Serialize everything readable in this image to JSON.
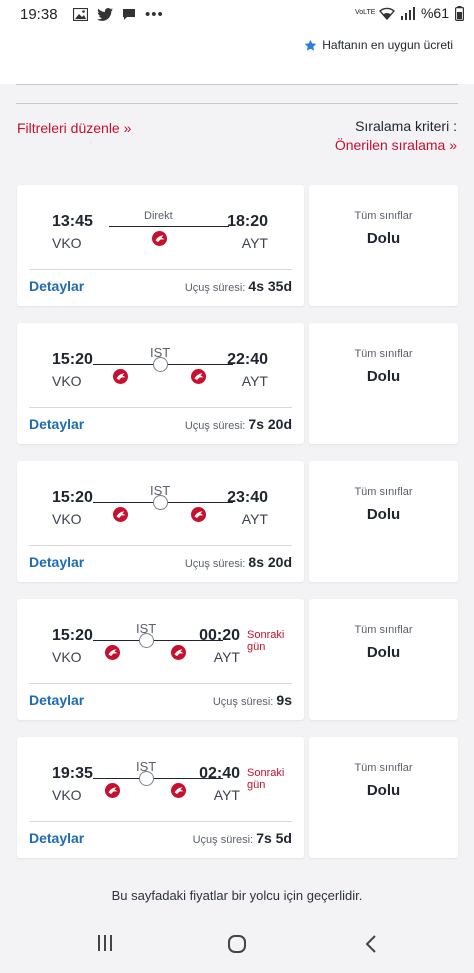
{
  "status_bar": {
    "time": "19:38",
    "battery": "%61",
    "network": "VoLTE"
  },
  "header": {
    "best_price_label": "Haftanın en uygun ücreti"
  },
  "filters": {
    "edit_label": "Filtreleri düzenle  »"
  },
  "sort": {
    "label": "Sıralama kriteri :",
    "value": "Önerilen sıralama  »"
  },
  "flights": [
    {
      "dep_time": "13:45",
      "dep_code": "VKO",
      "arr_time": "18:20",
      "arr_code": "AYT",
      "stop": "Direkt",
      "next_day": "",
      "details": "Detaylar",
      "duration_label": "Uçuş süresi:",
      "duration": "4s 35d",
      "fare_class": "Tüm sınıflar",
      "fare_status": "Dolu"
    },
    {
      "dep_time": "15:20",
      "dep_code": "VKO",
      "arr_time": "22:40",
      "arr_code": "AYT",
      "stop": "IST",
      "next_day": "",
      "details": "Detaylar",
      "duration_label": "Uçuş süresi:",
      "duration": "7s 20d",
      "fare_class": "Tüm sınıflar",
      "fare_status": "Dolu"
    },
    {
      "dep_time": "15:20",
      "dep_code": "VKO",
      "arr_time": "23:40",
      "arr_code": "AYT",
      "stop": "IST",
      "next_day": "",
      "details": "Detaylar",
      "duration_label": "Uçuş süresi:",
      "duration": "8s 20d",
      "fare_class": "Tüm sınıflar",
      "fare_status": "Dolu"
    },
    {
      "dep_time": "15:20",
      "dep_code": "VKO",
      "arr_time": "00:20",
      "arr_code": "AYT",
      "stop": "IST",
      "next_day": "Sonraki gün",
      "details": "Detaylar",
      "duration_label": "Uçuş süresi:",
      "duration": "9s",
      "fare_class": "Tüm sınıflar",
      "fare_status": "Dolu"
    },
    {
      "dep_time": "19:35",
      "dep_code": "VKO",
      "arr_time": "02:40",
      "arr_code": "AYT",
      "stop": "IST",
      "next_day": "Sonraki gün",
      "details": "Detaylar",
      "duration_label": "Uçuş süresi:",
      "duration": "7s 5d",
      "fare_class": "Tüm sınıflar",
      "fare_status": "Dolu"
    }
  ],
  "footer": {
    "note": "Bu sayfadaki fiyatlar bir yolcu için geçerlidir."
  },
  "colors": {
    "brand_red": "#c8102e",
    "link_blue": "#1f6bb3",
    "star_blue": "#2b7de9"
  },
  "icons": [
    "gallery-icon",
    "twitter-icon",
    "chat-icon",
    "wifi-icon",
    "signal-icon",
    "battery-icon",
    "star-icon",
    "turkish-airlines-logo-icon",
    "recent-apps-icon",
    "home-icon",
    "back-icon"
  ]
}
